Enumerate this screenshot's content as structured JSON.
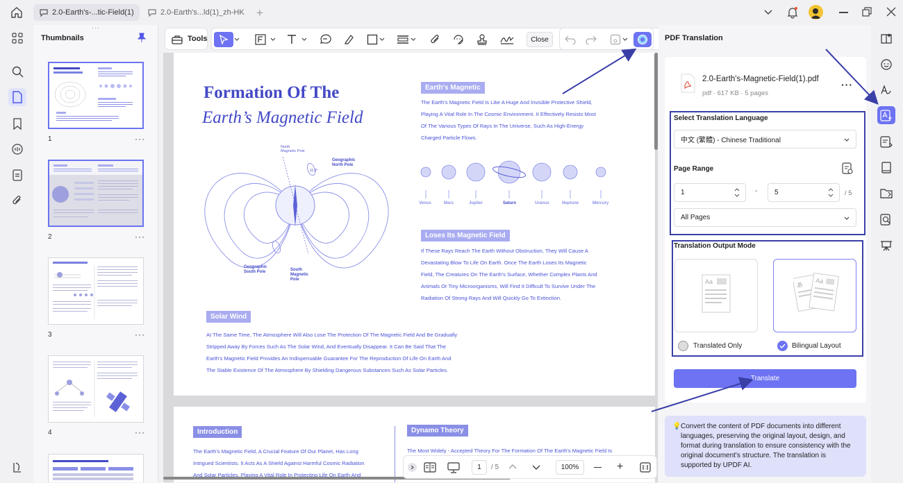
{
  "tabs": [
    {
      "label": "2.0-Earth's-...tic-Field(1)",
      "active": true
    },
    {
      "label": "2.0-Earth's...ld(1)_zh-HK",
      "active": false
    }
  ],
  "thumbnails": {
    "title": "Thumbnails",
    "pages": [
      "1",
      "2",
      "3",
      "4"
    ],
    "more": "···"
  },
  "toolbar": {
    "tools_label": "Tools",
    "close_label": "Close"
  },
  "page1": {
    "title_line1": "Formation Of The",
    "title_line2": "Earth’s Magnetic Field",
    "diagram_labels": {
      "north_magnetic": "North\nMagnetic Pole",
      "geo_north": "Geographic\nNorth Pole",
      "geo_south": "Geographic\nSouth Pole",
      "south_magnetic": "South\nMagnetic\nPole",
      "angle": "11.5°"
    },
    "section1_head": "Earth's Magnetic",
    "section1_lines": [
      "The Earth's Magnetic Field Is Like A Huge And Invisible Protective Shield,",
      "Playing A Vital Role In The Cosmic Environment. It Effectively Resists Most",
      "Of The Various Types Of Rays In The Universe, Such As High-Energy",
      "Charged Particle Flows."
    ],
    "planets": [
      "Venus",
      "Mars",
      "Jupiter",
      "Saturn",
      "Uranus",
      "Neptune",
      "Mercury"
    ],
    "section2_head": "Loses Its Magnetic Field",
    "section2_lines": [
      "If These Rays Reach The Earth Without Obstruction, They Will Cause A",
      "Devastating Blow To Life On Earth. Once The Earth Loses Its Magnetic",
      "Field, The Creatures On The Earth's Surface, Whether Complex Plants And",
      "Animals Or Tiny Microorganisms, Will Find It Difficult To Survive Under The",
      "Radiation Of Strong Rays And Will Quickly Go To Extinction."
    ],
    "section3_head": "Solar Wind",
    "section3_lines": [
      "At The Same Time, The Atmosphere Will Also Lose The Protection Of The Magnetic Field And Be Gradually",
      "Stripped Away By Forces Such As The Solar Wind, And Eventually Disappear. It Can Be Said That The",
      "Earth's Magnetic Field Provides An Indispensable Guarantee For The Reproduction Of Life On Earth And",
      "The Stable Existence Of The Atmosphere By Shielding Dangerous Substances Such As Solar Particles."
    ]
  },
  "page2": {
    "intro_head": "Introduction",
    "intro_lines": [
      "The Earth's Magnetic Field, A Crucial Feature Of Our Planet, Has Long",
      "Intrigued Scientists. It Acts As A Shield Against Harmful Cosmic Radiation",
      "And Solar Particles, Playing A Vital Role In Protecting Life On Earth And"
    ],
    "dynamo_head": "Dynamo Theory",
    "dynamo_lines": [
      "The Most Widely - Accepted Theory For The Formation Of The Earth's Magnetic Field Is"
    ]
  },
  "bottombar": {
    "page_current": "1",
    "page_total": "/ 5",
    "zoom": "100%"
  },
  "panel": {
    "title": "PDF Translation",
    "file_name": "2.0-Earth's-Magnetic-Field(1).pdf",
    "file_meta": "pdf · 617 KB · 5 pages",
    "lang_label": "Select Translation Language",
    "lang_value": "中文 (繁體) - Chinese Traditional",
    "range_label": "Page Range",
    "range_from": "1",
    "range_dash": "-",
    "range_to": "5",
    "range_total": "/ 5",
    "pages_value": "All Pages",
    "mode_label": "Translation Output Mode",
    "mode_translated": "Translated Only",
    "mode_bilingual": "Bilingual Layout",
    "translate_label": "Translate",
    "info_text": "Convert the content of PDF documents into different languages, preserving the original layout, design, and format during translation to ensure consistency with the original document's structure. The translation is supported by UPDF AI."
  },
  "colors": {
    "accent": "#6d73f2",
    "doc_blue": "#4349c5",
    "annotation": "#3a3fa8"
  }
}
